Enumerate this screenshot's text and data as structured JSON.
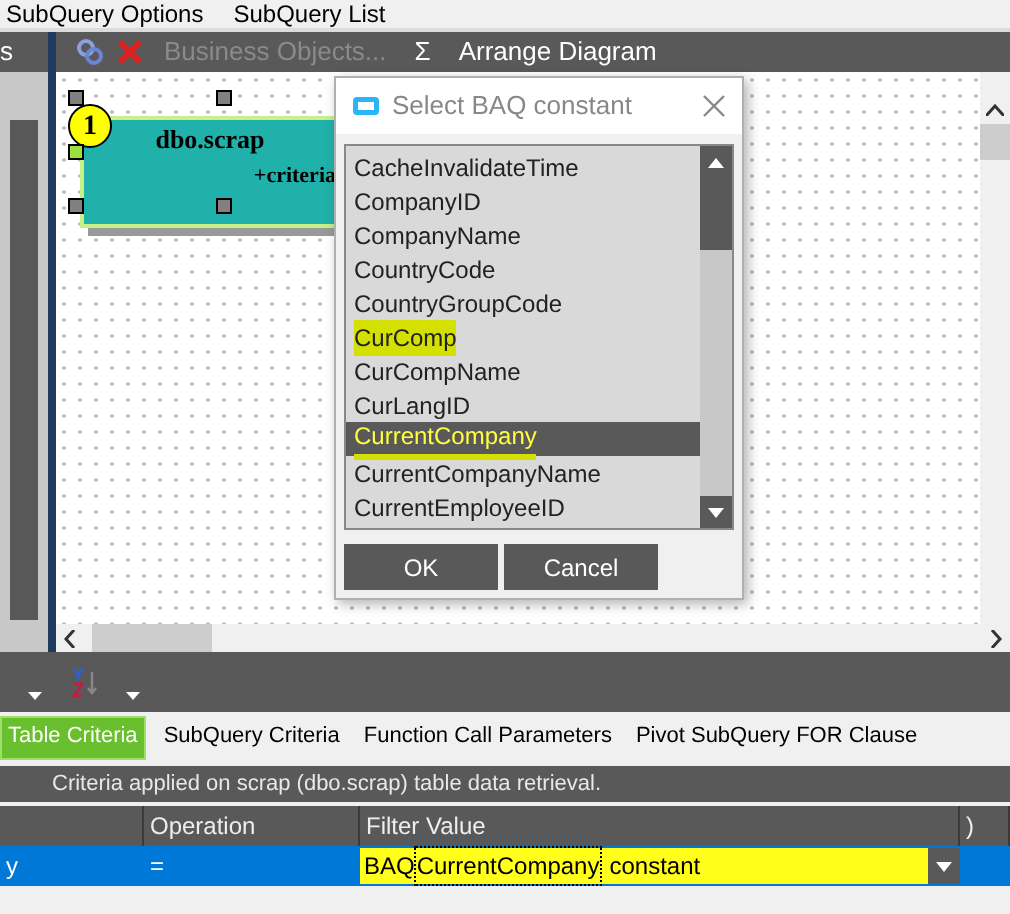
{
  "menu": [
    "SubQuery Options",
    "SubQuery List"
  ],
  "left_panel": {
    "label": "s"
  },
  "toolbar": {
    "items": [
      {
        "kind": "link"
      },
      {
        "kind": "delete"
      },
      {
        "kind": "text",
        "label": "Business Objects...",
        "disabled": true
      },
      {
        "kind": "text",
        "label": "Σ",
        "disabled": false
      },
      {
        "kind": "text",
        "label": "Arrange Diagram",
        "disabled": false
      }
    ]
  },
  "diagram": {
    "node": {
      "badge": "1",
      "title": "dbo.scrap",
      "subtitle": "+criteria"
    }
  },
  "dialog": {
    "title": "Select BAQ constant",
    "items": [
      {
        "label": "CacheInvalidateTime",
        "selected": false,
        "highlighted": false
      },
      {
        "label": "CompanyID",
        "selected": false,
        "highlighted": false
      },
      {
        "label": "CompanyName",
        "selected": false,
        "highlighted": false
      },
      {
        "label": "CountryCode",
        "selected": false,
        "highlighted": false
      },
      {
        "label": "CountryGroupCode",
        "selected": false,
        "highlighted": false
      },
      {
        "label": "CurComp",
        "selected": false,
        "highlighted": true
      },
      {
        "label": "CurCompName",
        "selected": false,
        "highlighted": false
      },
      {
        "label": "CurLangID",
        "selected": false,
        "highlighted": false
      },
      {
        "label": "CurrentCompany",
        "selected": true,
        "highlighted": true
      },
      {
        "label": "CurrentCompanyName",
        "selected": false,
        "highlighted": false
      },
      {
        "label": "CurrentEmployeeID",
        "selected": false,
        "highlighted": false
      }
    ],
    "buttons": [
      "OK",
      "Cancel"
    ]
  },
  "tabs": [
    {
      "label": "Table Criteria",
      "selected": true
    },
    {
      "label": "SubQuery Criteria",
      "selected": false
    },
    {
      "label": "Function Call Parameters",
      "selected": false
    },
    {
      "label": "Pivot SubQuery FOR Clause",
      "selected": false
    }
  ],
  "info": "Criteria applied on scrap (dbo.scrap) table data retrieval.",
  "grid": {
    "columns": [
      "",
      "Operation",
      "Filter Value",
      ")"
    ],
    "row": {
      "selected": true,
      "column_1": "y",
      "operation": "=",
      "filter_value": {
        "prefix": "BAQ",
        "token": "CurrentCompany",
        "suffix": "constant",
        "highlighted": true
      }
    }
  }
}
